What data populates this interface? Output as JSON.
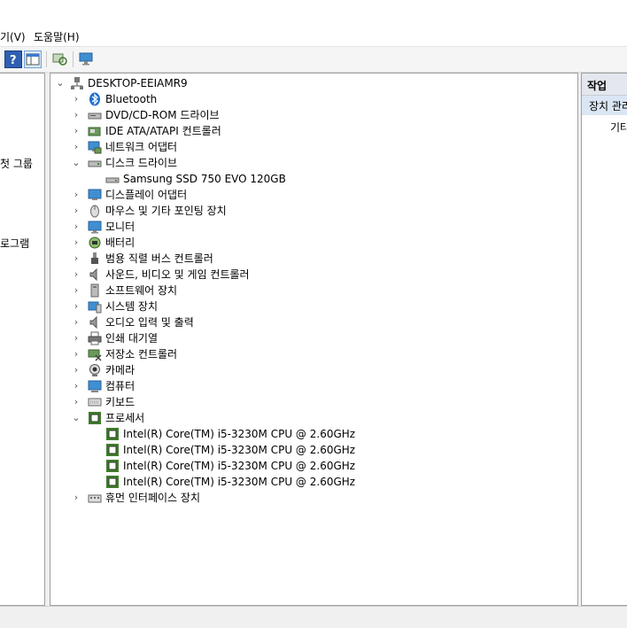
{
  "menu": {
    "view_label": "기(V)",
    "help_label": "도움말(H)"
  },
  "left_pane": {
    "fragment_1": "첫 그룹",
    "fragment_2": "로그램"
  },
  "tree": {
    "root": "DESKTOP-EEIAMR9",
    "categories": {
      "bluetooth": "Bluetooth",
      "dvd": "DVD/CD-ROM 드라이브",
      "ide": "IDE ATA/ATAPI 컨트롤러",
      "network": "네트워크 어댑터",
      "disk": "디스크 드라이브",
      "disk_child": "Samsung SSD 750 EVO 120GB",
      "display": "디스플레이 어댑터",
      "mouse": "마우스 및 기타 포인팅 장치",
      "monitor": "모니터",
      "battery": "배터리",
      "usb": "범용 직렬 버스 컨트롤러",
      "sound": "사운드, 비디오 및 게임 컨트롤러",
      "software": "소프트웨어 장치",
      "system": "시스템 장치",
      "audio_io": "오디오 입력 및 출력",
      "print_queue": "인쇄 대기열",
      "storage": "저장소 컨트롤러",
      "camera": "카메라",
      "computer": "컴퓨터",
      "keyboard": "키보드",
      "processor": "프로세서",
      "hid": "휴먼 인터페이스 장치"
    },
    "processor_children": [
      "Intel(R) Core(TM) i5-3230M CPU @ 2.60GHz",
      "Intel(R) Core(TM) i5-3230M CPU @ 2.60GHz",
      "Intel(R) Core(TM) i5-3230M CPU @ 2.60GHz",
      "Intel(R) Core(TM) i5-3230M CPU @ 2.60GHz"
    ]
  },
  "actions": {
    "header": "작업",
    "item_1": "장치 관리",
    "item_2": "기타"
  },
  "colors": {
    "accent": "#0078d7",
    "selection": "#dbe6f4",
    "chip_green": "#3e7d2a"
  }
}
